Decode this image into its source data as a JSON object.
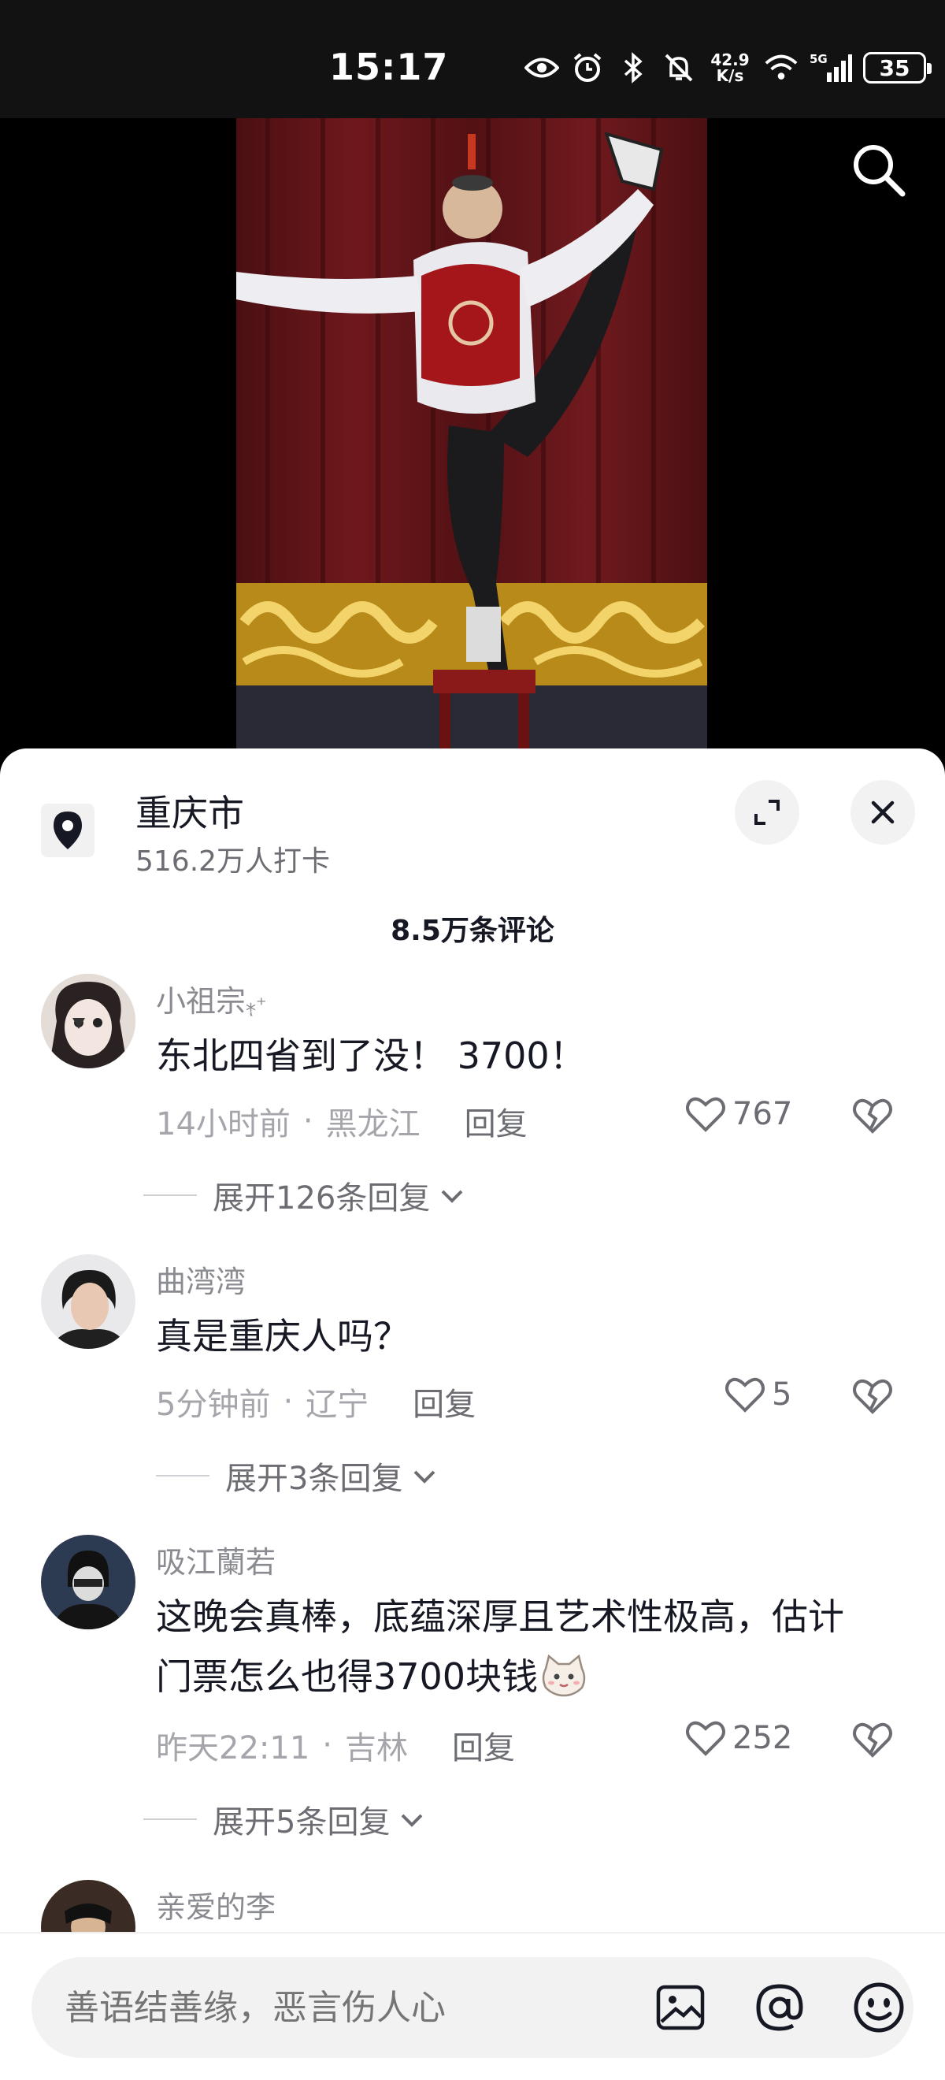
{
  "status_bar": {
    "time": "15:17",
    "net_speed_value": "42.9",
    "net_speed_unit": "K/s",
    "network": "5G",
    "battery": "35",
    "icons": [
      "eye-icon",
      "alarm-icon",
      "bluetooth-icon",
      "mute-icon",
      "wifi-icon",
      "signal-icon",
      "battery-icon"
    ]
  },
  "video": {
    "search_icon": "search-icon"
  },
  "location": {
    "name": "重庆市",
    "checkins": "516.2万人打卡",
    "icon": "map-pin-icon"
  },
  "comments_header": {
    "count": "8.5万条评论"
  },
  "comments": [
    {
      "user": "小祖宗",
      "user_suffix": "⁎ͅ⁺",
      "text": "东北四省到了没！ 3700！",
      "time": "14小时前",
      "location": "黑龙江",
      "reply": "回复",
      "likes": "767",
      "expand": "展开126条回复"
    },
    {
      "user": "曲湾湾",
      "text": "真是重庆人吗？",
      "time": "5分钟前",
      "location": "辽宁",
      "reply": "回复",
      "likes": "5",
      "expand": "展开3条回复"
    },
    {
      "user": "吸江蘭若",
      "text_line1": "这晚会真棒，底蕴深厚且艺术性极高，估计",
      "text_line2": "门票怎么也得3700块钱",
      "time": "昨天22:11",
      "location": "吉林",
      "reply": "回复",
      "likes": "252",
      "expand": "展开5条回复"
    },
    {
      "user": "亲爱的李"
    }
  ],
  "input": {
    "placeholder": "善语结善缘，恶言伤人心",
    "icons": [
      "image-icon",
      "at-icon",
      "emoji-icon"
    ]
  }
}
